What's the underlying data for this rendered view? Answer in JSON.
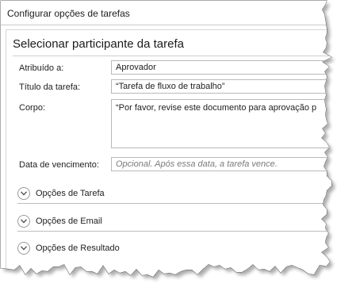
{
  "window": {
    "title": "Configurar opções de tarefas"
  },
  "section": {
    "title": "Selecionar participante da tarefa"
  },
  "fields": {
    "assigned": {
      "label": "Atribuído a:",
      "value": "Aprovador"
    },
    "task_title": {
      "label": "Título da tarefa:",
      "value": "“Tarefa de fluxo de trabalho”"
    },
    "body": {
      "label": "Corpo:",
      "value": "“Por favor, revise este documento para aprovação p"
    },
    "due_date": {
      "label": "Data de vencimento:",
      "placeholder": "Opcional. Após essa data, a tarefa vence."
    }
  },
  "expanders": [
    {
      "label": "Opções de Tarefa"
    },
    {
      "label": "Opções de Email"
    },
    {
      "label": "Opções de Resultado"
    }
  ],
  "icons": [
    "chevron-down-icon"
  ]
}
